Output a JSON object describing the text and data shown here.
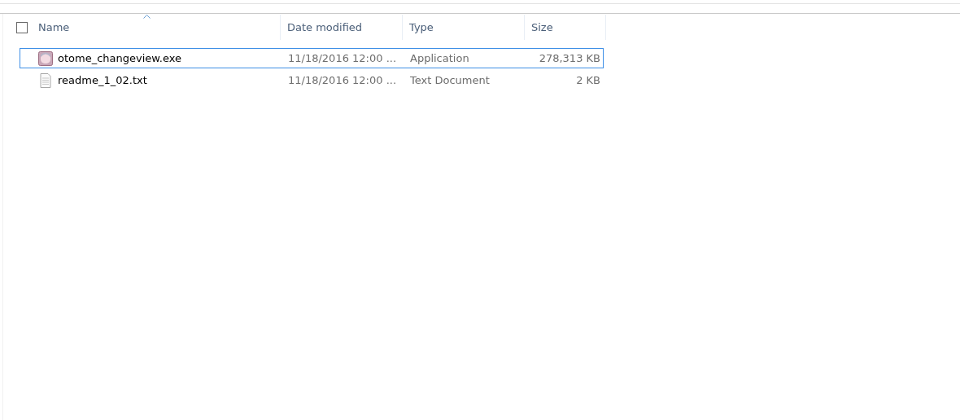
{
  "columns": [
    {
      "label": "Name",
      "sorted": true
    },
    {
      "label": "Date modified",
      "sorted": false
    },
    {
      "label": "Type",
      "sorted": false
    },
    {
      "label": "Size",
      "sorted": false
    }
  ],
  "select_all": {
    "checked": false
  },
  "rows": [
    {
      "kind": "app",
      "name": "otome_changeview.exe",
      "date": "11/18/2016 12:00 ...",
      "type": "Application",
      "size": "278,313 KB",
      "focused": true
    },
    {
      "kind": "text",
      "name": "readme_1_02.txt",
      "date": "11/18/2016 12:00 ...",
      "type": "Text Document",
      "size": "2 KB",
      "focused": false
    }
  ]
}
